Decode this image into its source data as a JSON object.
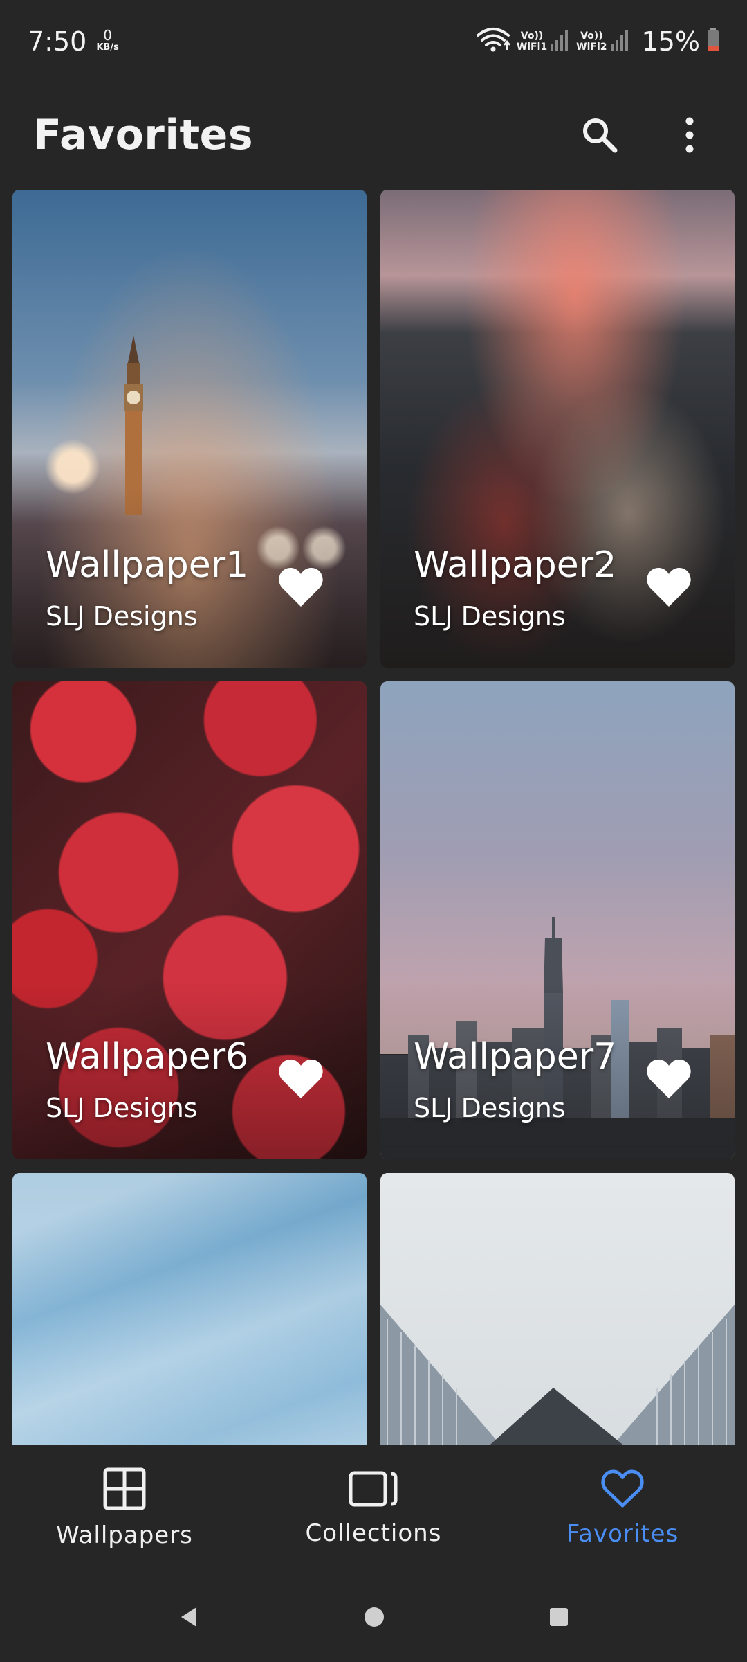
{
  "status_bar": {
    "time": "7:50",
    "net_speed_value": "0",
    "net_speed_unit": "KB/s",
    "sim1_label_top": "Vo))",
    "sim1_label_bottom": "WiFi1",
    "sim2_label_top": "Vo))",
    "sim2_label_bottom": "WiFi2",
    "battery": "15%"
  },
  "app_bar": {
    "title": "Favorites",
    "search_icon": "search-icon",
    "menu_icon": "more-vert-icon"
  },
  "cards": [
    {
      "title": "Wallpaper1",
      "author": "SLJ Designs",
      "favorited": true
    },
    {
      "title": "Wallpaper2",
      "author": "SLJ Designs",
      "favorited": true
    },
    {
      "title": "Wallpaper6",
      "author": "SLJ Designs",
      "favorited": true
    },
    {
      "title": "Wallpaper7",
      "author": "SLJ Designs",
      "favorited": true
    }
  ],
  "bottom_nav": {
    "items": [
      {
        "label": "Wallpapers",
        "icon": "grid-icon",
        "active": false
      },
      {
        "label": "Collections",
        "icon": "collections-icon",
        "active": false
      },
      {
        "label": "Favorites",
        "icon": "heart-icon",
        "active": true
      }
    ],
    "active_color": "#4a8ef3"
  }
}
